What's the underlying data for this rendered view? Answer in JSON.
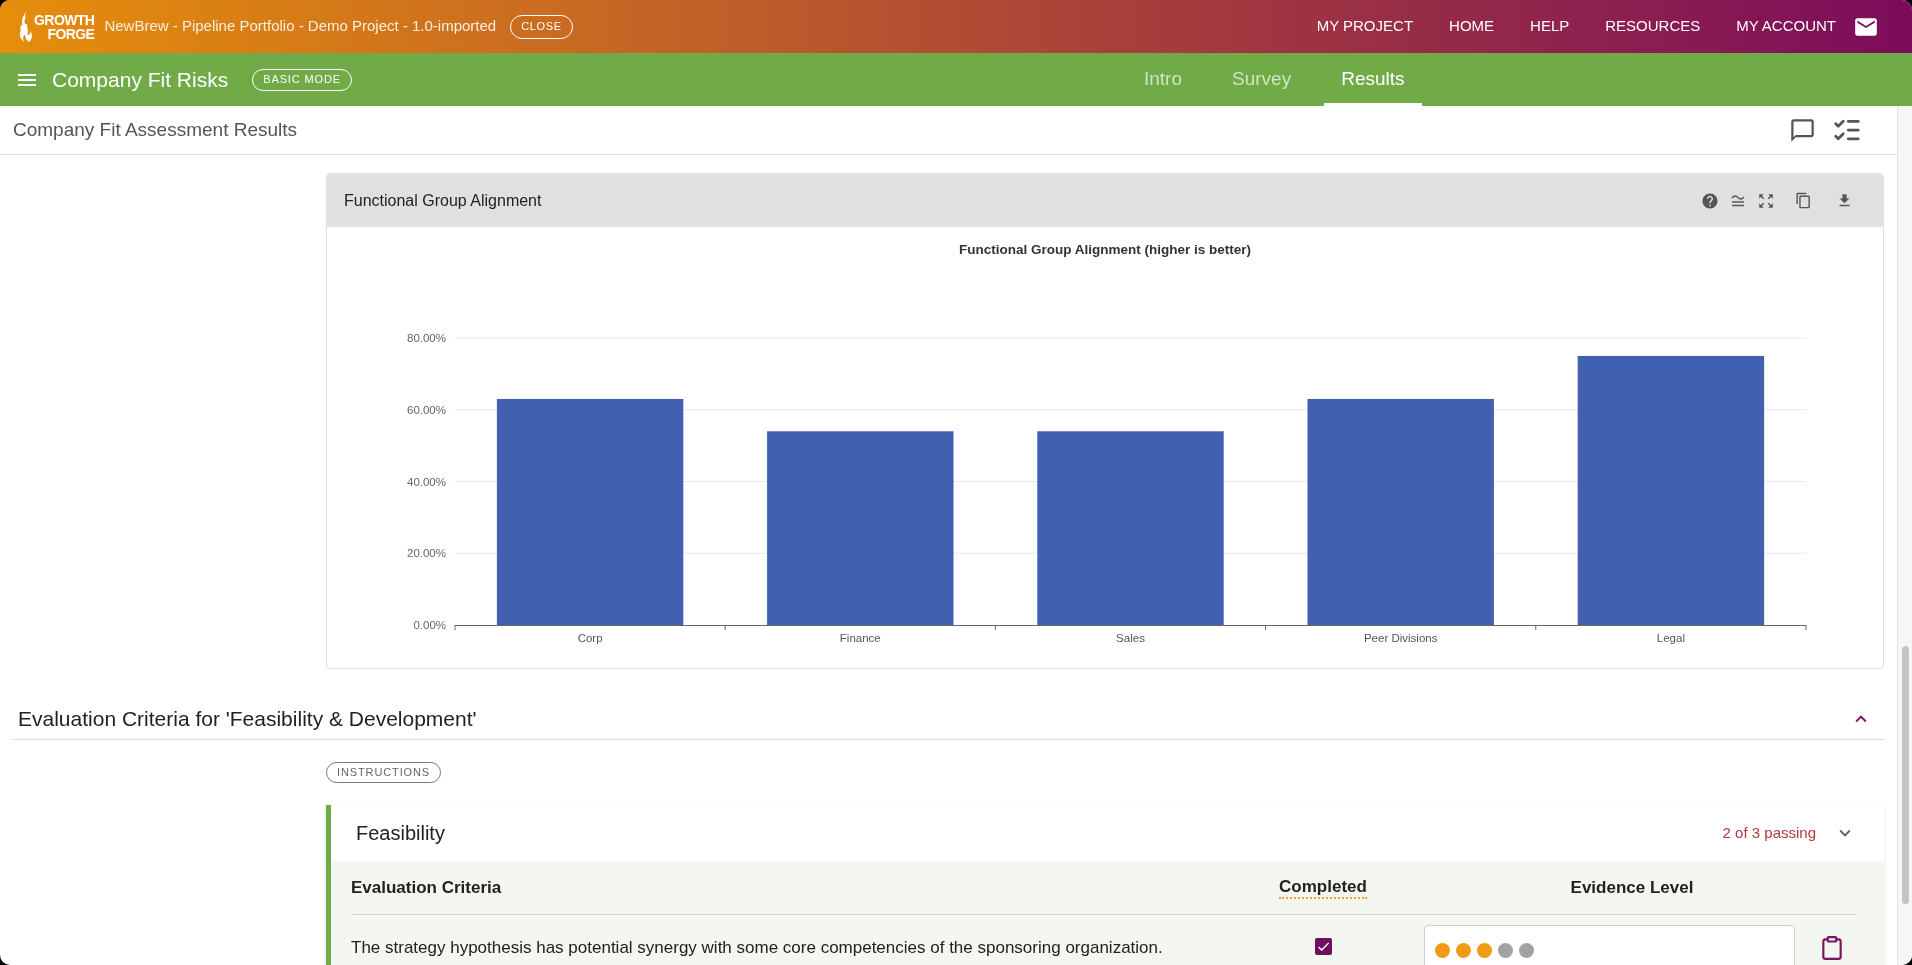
{
  "top_bar": {
    "logo": {
      "line1": "GROWTH",
      "line2": "FORGE"
    },
    "project_title": "NewBrew - Pipeline Portfolio - Demo Project - 1.0-imported",
    "close_button": "CLOSE",
    "nav": [
      "MY PROJECT",
      "HOME",
      "HELP",
      "RESOURCES",
      "MY ACCOUNT"
    ]
  },
  "module_bar": {
    "title": "Company Fit Risks",
    "mode_badge": "BASIC MODE",
    "tabs": [
      {
        "label": "Intro",
        "selected": false
      },
      {
        "label": "Survey",
        "selected": false
      },
      {
        "label": "Results",
        "selected": true
      }
    ]
  },
  "page_header": {
    "title": "Company Fit Assessment Results"
  },
  "chart_card": {
    "title": "Functional Group Alignment",
    "chart_data": {
      "type": "bar",
      "title": "Functional Group Alignment (higher is better)",
      "categories": [
        "Corp",
        "Finance",
        "Sales",
        "Peer Divisions",
        "Legal"
      ],
      "values": [
        63,
        54,
        54,
        63,
        75
      ],
      "ylim": [
        0,
        80
      ],
      "yticks": [
        {
          "value": 0,
          "label": "0.00%"
        },
        {
          "value": 20,
          "label": "20.00%"
        },
        {
          "value": 40,
          "label": "40.00%"
        },
        {
          "value": 60,
          "label": "60.00%"
        },
        {
          "value": 80,
          "label": "80.00%"
        }
      ],
      "grid": true
    }
  },
  "criteria_section": {
    "title": "Evaluation Criteria for 'Feasibility & Development'",
    "expanded": true,
    "instructions_button": "INSTRUCTIONS",
    "groups": [
      {
        "title": "Feasibility",
        "status": "2 of 3 passing",
        "columns": [
          "Evaluation Criteria",
          "Completed",
          "Evidence Level"
        ],
        "rows": [
          {
            "criterion": "The strategy hypothesis has potential synergy with some core competencies of the sponsoring organization.",
            "completed": true,
            "stars": 3
          }
        ]
      }
    ]
  }
}
